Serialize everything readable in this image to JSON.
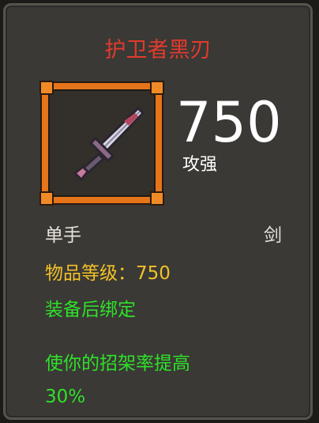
{
  "tooltip": {
    "item_name": "护卫者黑刃",
    "icon": "sword-icon",
    "stat_value": "750",
    "stat_label": "攻强",
    "slot": "单手",
    "weapon_type": "剑",
    "item_level": "物品等级：750",
    "bind": "装备后绑定",
    "effect_line1": "使你的招架率提高",
    "effect_line2": "30%"
  },
  "colors": {
    "name_red": "#e23a2e",
    "item_level_gold": "#f2c128",
    "green_text": "#2fe02a",
    "frame_orange": "#e5741a"
  }
}
